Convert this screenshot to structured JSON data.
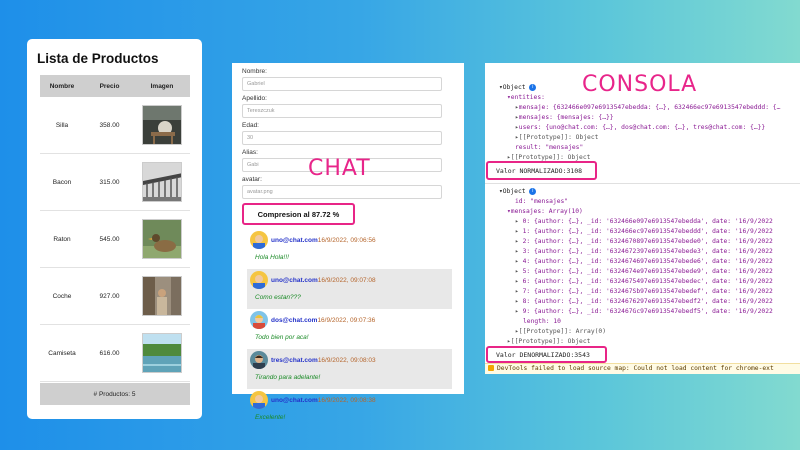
{
  "products": {
    "title": "Lista de Productos",
    "headers": [
      "Nombre",
      "Precio",
      "Imagen"
    ],
    "rows": [
      {
        "name": "Silla",
        "price": "358.00",
        "image": "chair-bird-photo"
      },
      {
        "name": "Bacon",
        "price": "315.00",
        "image": "bridge-photo"
      },
      {
        "name": "Raton",
        "price": "545.00",
        "image": "duck-photo"
      },
      {
        "name": "Coche",
        "price": "927.00",
        "image": "street-photo"
      },
      {
        "name": "Camiseta",
        "price": "616.00",
        "image": "lake-photo"
      }
    ],
    "footer": "# Productos: 5"
  },
  "chat": {
    "overlay_label": "CHAT",
    "fields": [
      {
        "label": "Nombre:",
        "value": "Gabriel"
      },
      {
        "label": "Apellido:",
        "value": "Tereszczuk"
      },
      {
        "label": "Edad:",
        "value": "30"
      },
      {
        "label": "Alias:",
        "value": "Gabi"
      },
      {
        "label": "avatar:",
        "value": "avatar.png"
      }
    ],
    "compression": "Compresion al 87.72 %",
    "messages": [
      {
        "author": "uno@chat.com",
        "date": "16/9/2022, 09:06:56",
        "text": "Hola Hola!!!"
      },
      {
        "author": "uno@chat.com",
        "date": "16/9/2022, 09:07:08",
        "text": "Como estan???"
      },
      {
        "author": "dos@chat.com",
        "date": "16/9/2022, 09:07:36",
        "text": "Todo bien por aca!"
      },
      {
        "author": "tres@chat.com",
        "date": "16/9/2022, 09:08:03",
        "text": "Tirando para adelante!"
      },
      {
        "author": "uno@chat.com",
        "date": "16/9/2022, 09:08:38",
        "text": "Excelente!"
      }
    ]
  },
  "console": {
    "overlay_label": "CONSOLA",
    "normalized_label": "Valor NORMALIZADO:3108",
    "denormalized_label": "Valor DENORMALIZADO:3543",
    "obj1": {
      "header": "Object",
      "entities": "entities:",
      "mensaje": "mensaje: {632466e097e6913547ebedda: {…}, 632466ec97e6913547ebeddd: {…",
      "mensajes": "mensajes: {mensajes: {…}}",
      "users": "users: {uno@chat.com: {…}, dos@chat.com: {…}, tres@chat.com: {…}}",
      "proto_inner": "[[Prototype]]: Object",
      "result": "result: \"mensajes\"",
      "proto_outer": "[[Prototype]]: Object"
    },
    "obj2": {
      "header": "Object",
      "id": "id: \"mensajes\"",
      "mensajes": "mensajes: Array(10)",
      "items": [
        "0: {author: {…}, _id: '632466e097e6913547ebedda', date: '16/9/2022",
        "1: {author: {…}, _id: '632466ec97e6913547ebeddd', date: '16/9/2022",
        "2: {author: {…}, _id: '6324670897e6913547ebede0', date: '16/9/2022",
        "3: {author: {…}, _id: '6324672397e6913547ebede3', date: '16/9/2022",
        "4: {author: {…}, _id: '6324674697e6913547ebede6', date: '16/9/2022",
        "5: {author: {…}, _id: '6324674e97e6913547ebede9', date: '16/9/2022",
        "6: {author: {…}, _id: '6324675497e6913547ebedec', date: '16/9/2022",
        "7: {author: {…}, _id: '632467Sb97e6913547ebedef', date: '16/9/2022",
        "8: {author: {…}, _id: '6324676297e6913547ebedf2', date: '16/9/2022",
        "9: {author: {…}, _id: '632467Gc97e6913547ebedf5', date: '16/9/2022"
      ],
      "length": "length: 10",
      "proto_array": "[[Prototype]]: Array(0)",
      "proto_obj": "[[Prototype]]: Object"
    },
    "warning": "DevTools failed to load source map: Could not load content for chrome-ext"
  },
  "colors": {
    "accent": "#e8258a",
    "author": "#2432c9",
    "date": "#b5652b",
    "message": "#1a8a26"
  }
}
